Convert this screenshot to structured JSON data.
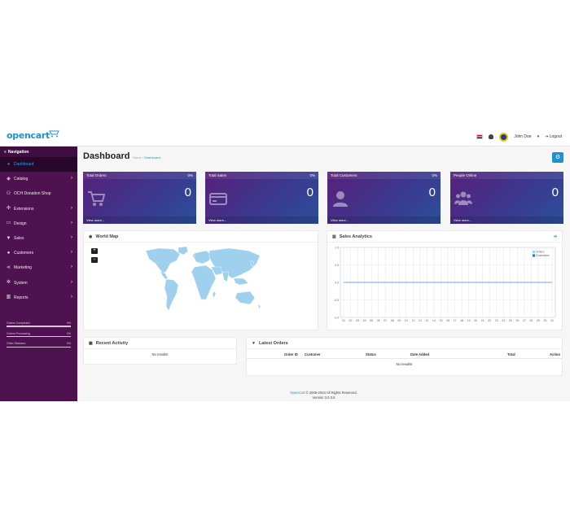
{
  "header": {
    "logo_text": "opencart",
    "user_name": "John Doe",
    "logout_label": "Logout"
  },
  "sidebar": {
    "title": "Navigation",
    "items": [
      {
        "label": "Dashboard",
        "icon": "dashboard-icon"
      },
      {
        "label": "Catalog",
        "icon": "tag-icon"
      },
      {
        "label": "OCH Donation Shop",
        "icon": "donation-icon"
      },
      {
        "label": "Extensions",
        "icon": "puzzle-icon"
      },
      {
        "label": "Design",
        "icon": "monitor-icon"
      },
      {
        "label": "Sales",
        "icon": "cart-icon"
      },
      {
        "label": "Customers",
        "icon": "user-icon"
      },
      {
        "label": "Marketing",
        "icon": "share-icon"
      },
      {
        "label": "System",
        "icon": "gear-icon"
      },
      {
        "label": "Reports",
        "icon": "bar-chart-icon"
      }
    ],
    "progress": [
      {
        "label": "Orders Completed",
        "value": "0%"
      },
      {
        "label": "Orders Processing",
        "value": "0%"
      },
      {
        "label": "Other Statuses",
        "value": "0%"
      }
    ]
  },
  "page": {
    "title": "Dashboard",
    "breadcrumb": [
      "Home",
      "Dashboard"
    ]
  },
  "tiles": [
    {
      "title": "Total Orders",
      "percent": "0%",
      "value": "0",
      "link": "View more..."
    },
    {
      "title": "Total Sales",
      "percent": "0%",
      "value": "0",
      "link": "View more..."
    },
    {
      "title": "Total Customers",
      "percent": "0%",
      "value": "0",
      "link": "View more..."
    },
    {
      "title": "People Online",
      "percent": "",
      "value": "0",
      "link": "View more..."
    }
  ],
  "world_map": {
    "title": "World Map",
    "zoom_in": "+",
    "zoom_out": "−"
  },
  "sales": {
    "title": "Sales Analytics",
    "legend": [
      "Orders",
      "Customers"
    ]
  },
  "recent": {
    "title": "Recent Activity",
    "empty": "No results!"
  },
  "latest_orders": {
    "title": "Latest Orders",
    "columns": [
      "Order ID",
      "Customer",
      "Status",
      "Date Added",
      "Total",
      "Action"
    ],
    "empty": "No results!"
  },
  "footer": {
    "brand": "OpenCart",
    "copyright": "© 2009-2024 All Rights Reserved.",
    "version": "Version 3.0.3.8"
  },
  "chart_data": {
    "type": "line",
    "title": "",
    "xlabel": "",
    "ylabel": "",
    "x": [
      "01",
      "02",
      "03",
      "04",
      "05",
      "06",
      "07",
      "08",
      "09",
      "10",
      "11",
      "12",
      "13",
      "14",
      "15",
      "16",
      "17",
      "18",
      "19",
      "20",
      "21",
      "22",
      "23",
      "24",
      "25",
      "26",
      "27",
      "28",
      "29",
      "30",
      "31"
    ],
    "y_ticks": [
      "1.0",
      "0.5",
      "0.0",
      "-0.5",
      "-1.0"
    ],
    "ylim": [
      -1.0,
      1.0
    ],
    "grid": true,
    "legend_position": "top-right",
    "series": [
      {
        "name": "Orders",
        "color": "#9fd0ee",
        "values": [
          0,
          0,
          0,
          0,
          0,
          0,
          0,
          0,
          0,
          0,
          0,
          0,
          0,
          0,
          0,
          0,
          0,
          0,
          0,
          0,
          0,
          0,
          0,
          0,
          0,
          0,
          0,
          0,
          0,
          0,
          0
        ]
      },
      {
        "name": "Customers",
        "color": "#1e6fd0",
        "values": [
          0,
          0,
          0,
          0,
          0,
          0,
          0,
          0,
          0,
          0,
          0,
          0,
          0,
          0,
          0,
          0,
          0,
          0,
          0,
          0,
          0,
          0,
          0,
          0,
          0,
          0,
          0,
          0,
          0,
          0,
          0
        ]
      }
    ]
  },
  "colors": {
    "brand": "#1e91cf",
    "sidebar": "#4e1250",
    "map_land": "#9fd0ee"
  }
}
